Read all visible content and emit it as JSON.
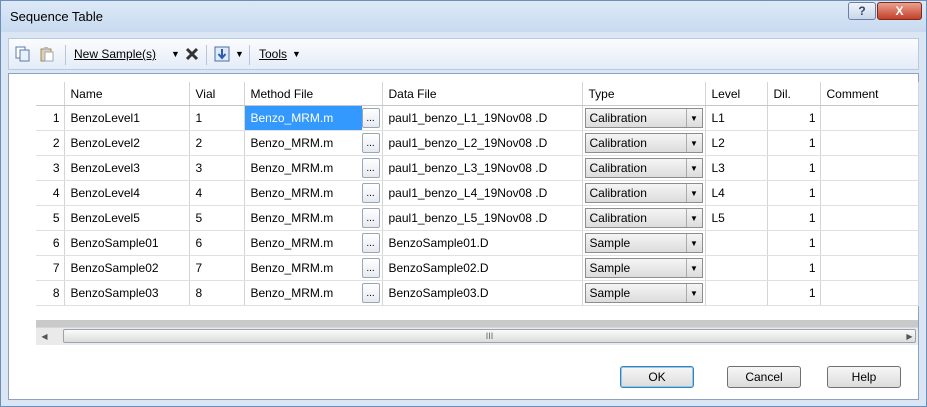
{
  "window": {
    "title": "Sequence Table",
    "help_glyph": "?",
    "close_glyph": "X"
  },
  "toolbar": {
    "new_samples_label": "New Sample(s)",
    "tools_label": "Tools"
  },
  "table": {
    "headers": [
      "",
      "Name",
      "Vial",
      "Method File",
      "Data File",
      "Type",
      "Level",
      "Dil.",
      "Comment"
    ],
    "rows": [
      {
        "idx": "1",
        "name": "BenzoLevel1",
        "vial": "1",
        "method": "Benzo_MRM.m",
        "data_file": "paul1_benzo_L1_19Nov08 .D",
        "type": "Calibration",
        "level": "L1",
        "dil": "1",
        "comment": ""
      },
      {
        "idx": "2",
        "name": "BenzoLevel2",
        "vial": "2",
        "method": "Benzo_MRM.m",
        "data_file": "paul1_benzo_L2_19Nov08 .D",
        "type": "Calibration",
        "level": "L2",
        "dil": "1",
        "comment": ""
      },
      {
        "idx": "3",
        "name": "BenzoLevel3",
        "vial": "3",
        "method": "Benzo_MRM.m",
        "data_file": "paul1_benzo_L3_19Nov08 .D",
        "type": "Calibration",
        "level": "L3",
        "dil": "1",
        "comment": ""
      },
      {
        "idx": "4",
        "name": "BenzoLevel4",
        "vial": "4",
        "method": "Benzo_MRM.m",
        "data_file": "paul1_benzo_L4_19Nov08 .D",
        "type": "Calibration",
        "level": "L4",
        "dil": "1",
        "comment": ""
      },
      {
        "idx": "5",
        "name": "BenzoLevel5",
        "vial": "5",
        "method": "Benzo_MRM.m",
        "data_file": "paul1_benzo_L5_19Nov08 .D",
        "type": "Calibration",
        "level": "L5",
        "dil": "1",
        "comment": ""
      },
      {
        "idx": "6",
        "name": "BenzoSample01",
        "vial": "6",
        "method": "Benzo_MRM.m",
        "data_file": "BenzoSample01.D",
        "type": "Sample",
        "level": "",
        "dil": "1",
        "comment": ""
      },
      {
        "idx": "7",
        "name": "BenzoSample02",
        "vial": "7",
        "method": "Benzo_MRM.m",
        "data_file": "BenzoSample02.D",
        "type": "Sample",
        "level": "",
        "dil": "1",
        "comment": ""
      },
      {
        "idx": "8",
        "name": "BenzoSample03",
        "vial": "8",
        "method": "Benzo_MRM.m",
        "data_file": "BenzoSample03.D",
        "type": "Sample",
        "level": "",
        "dil": "1",
        "comment": ""
      }
    ],
    "browse_glyph": "..."
  },
  "scrollbar": {
    "grip_glyph": "III"
  },
  "buttons": {
    "ok": "OK",
    "cancel": "Cancel",
    "help": "Help"
  }
}
